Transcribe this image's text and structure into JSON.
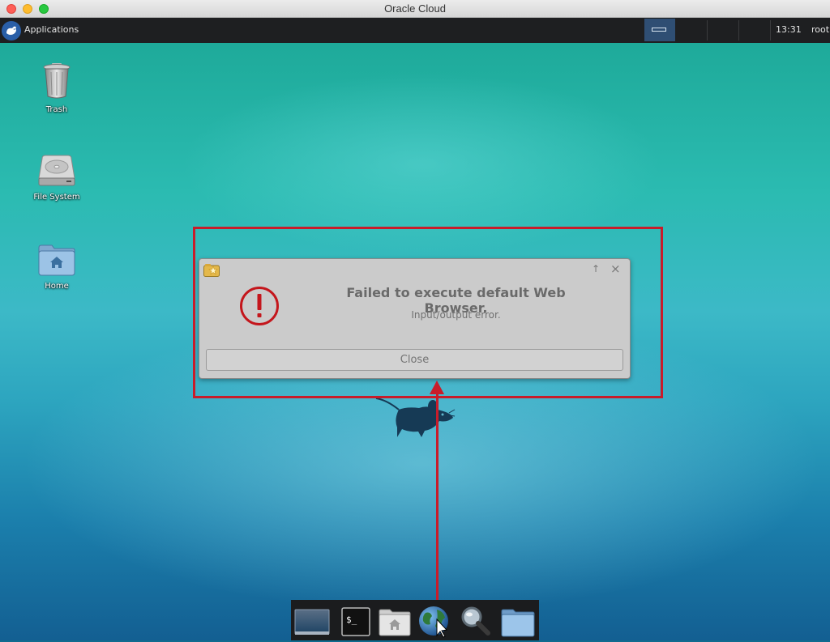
{
  "window": {
    "title": "Oracle Cloud"
  },
  "panel": {
    "applications_label": "Applications",
    "clock": "13:31",
    "user": "root"
  },
  "desktop_icons": [
    {
      "label": "Trash",
      "icon": "trash-icon"
    },
    {
      "label": "File System",
      "icon": "hard-drive-icon"
    },
    {
      "label": "Home",
      "icon": "home-folder-icon"
    }
  ],
  "dialog": {
    "title": "Failed to execute default Web Browser.",
    "message": "Input/output error.",
    "close_button": "Close"
  },
  "dock": {
    "items": [
      "show-desktop-icon",
      "terminal-icon",
      "home-folder-icon",
      "web-browser-icon",
      "search-icon",
      "folder-icon"
    ]
  },
  "colors": {
    "highlight": "#c81c2a",
    "error_icon": "#c4161c"
  }
}
